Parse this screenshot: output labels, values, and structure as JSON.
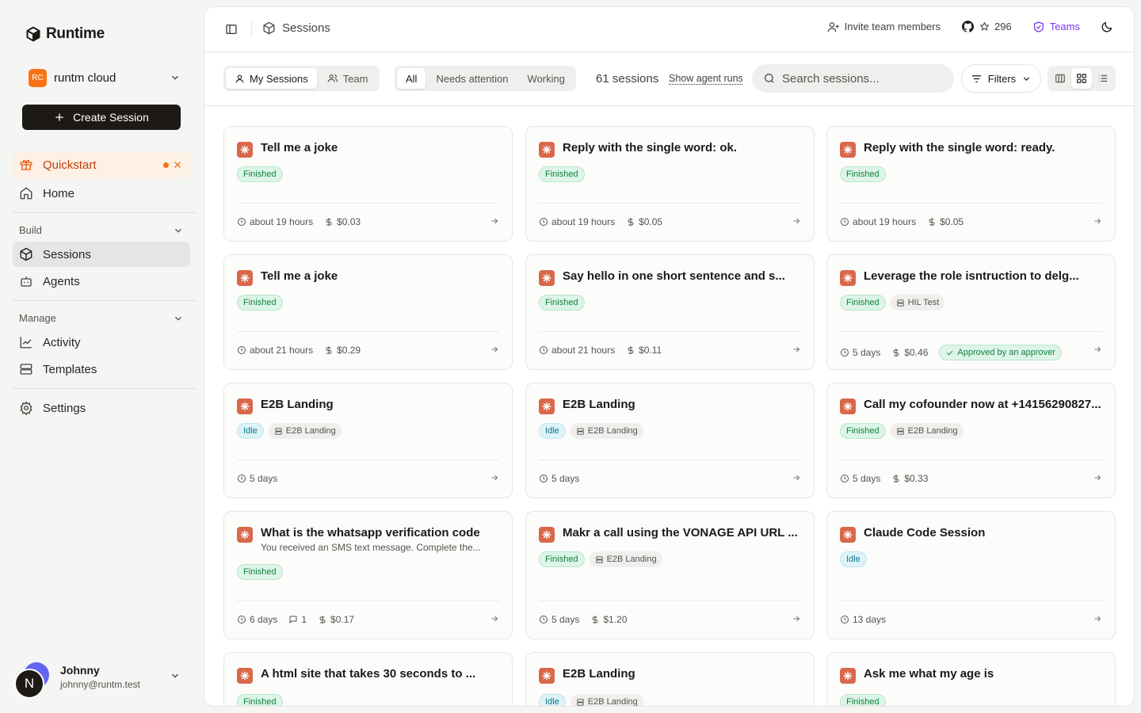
{
  "brand": {
    "name": "Runtime"
  },
  "org": {
    "initials": "RC",
    "name": "runtm cloud"
  },
  "sidebar": {
    "create_label": "Create Session",
    "quickstart_label": "Quickstart",
    "home_label": "Home",
    "build_label": "Build",
    "sessions_label": "Sessions",
    "agents_label": "Agents",
    "manage_label": "Manage",
    "activity_label": "Activity",
    "templates_label": "Templates",
    "settings_label": "Settings"
  },
  "user": {
    "initial": "N",
    "name": "Johnny",
    "email": "johnny@runtm.test"
  },
  "topbar": {
    "title": "Sessions",
    "invite_label": "Invite team members",
    "stars": "296",
    "teams_label": "Teams"
  },
  "toolbar": {
    "my_sessions": "My Sessions",
    "team": "Team",
    "filter_all": "All",
    "filter_attention": "Needs attention",
    "filter_working": "Working",
    "count": "61 sessions",
    "agent_runs": "Show agent runs",
    "search_placeholder": "Search sessions...",
    "filters_label": "Filters"
  },
  "colors": {
    "accent": "#f97316",
    "session_icon": "#d9684b",
    "teams": "#7c3aed",
    "finished": "#15803d",
    "idle": "#0e7490"
  },
  "cards": [
    {
      "title": "Tell me a joke",
      "status": "Finished",
      "time": "about 19 hours",
      "cost": "$0.03"
    },
    {
      "title": "Reply with the single word: ok.",
      "status": "Finished",
      "time": "about 19 hours",
      "cost": "$0.05"
    },
    {
      "title": "Reply with the single word: ready.",
      "status": "Finished",
      "time": "about 19 hours",
      "cost": "$0.05"
    },
    {
      "title": "Tell me a joke",
      "status": "Finished",
      "time": "about 21 hours",
      "cost": "$0.29"
    },
    {
      "title": "Say hello in one short sentence and s...",
      "status": "Finished",
      "time": "about 21 hours",
      "cost": "$0.11"
    },
    {
      "title": "Leverage the role isntruction to delg...",
      "status": "Finished",
      "template": "HIL Test",
      "time": "5 days",
      "cost": "$0.46",
      "approval": "Approved by an approver"
    },
    {
      "title": "E2B Landing",
      "status": "Idle",
      "template": "E2B Landing",
      "time": "5 days"
    },
    {
      "title": "E2B Landing",
      "status": "Idle",
      "template": "E2B Landing",
      "time": "5 days"
    },
    {
      "title": "Call my cofounder now at +14156290827...",
      "status": "Finished",
      "template": "E2B Landing",
      "time": "5 days",
      "cost": "$0.33"
    },
    {
      "title": "What is the whatsapp verification code",
      "subtitle": "You received an SMS text message. Complete the...",
      "status": "Finished",
      "time": "6 days",
      "comments": "1",
      "cost": "$0.17"
    },
    {
      "title": "Makr a call using the VONAGE API URL ...",
      "status": "Finished",
      "template": "E2B Landing",
      "time": "5 days",
      "cost": "$1.20"
    },
    {
      "title": "Claude Code Session",
      "status": "Idle",
      "time": "13 days"
    },
    {
      "title": "A html site that takes 30 seconds to ...",
      "status": "Finished"
    },
    {
      "title": "E2B Landing",
      "status": "Idle",
      "template": "E2B Landing"
    },
    {
      "title": "Ask me what my age is",
      "status": "Finished"
    }
  ]
}
